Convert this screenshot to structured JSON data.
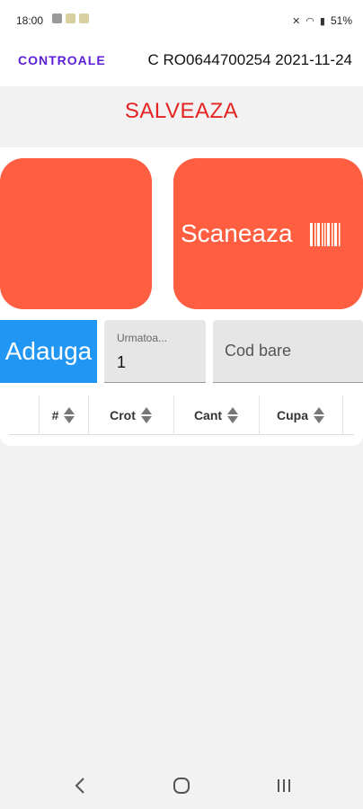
{
  "status_bar": {
    "time": "18:00",
    "battery": "51%"
  },
  "header": {
    "tab_label": "CONTROALE",
    "info": "C RO0644700254 2021-11-24"
  },
  "actions": {
    "save_label": "SALVEAZA",
    "scan_label": "Scaneaza",
    "add_label": "Adauga"
  },
  "form": {
    "next_label": "Urmatoa...",
    "next_value": "1",
    "barcode_placeholder": "Cod bare"
  },
  "table": {
    "columns": [
      "#",
      "Crot",
      "Cant",
      "Cupa"
    ]
  },
  "colors": {
    "tile": "#ff5f40",
    "add_button": "#2196f3",
    "save_text": "#e42323",
    "tab_text": "#5a1fd6"
  },
  "icons": {
    "scan": "barcode-icon",
    "sort": "sort-icon",
    "nav_back": "back-icon",
    "nav_home": "home-icon",
    "nav_recents": "recents-icon"
  }
}
